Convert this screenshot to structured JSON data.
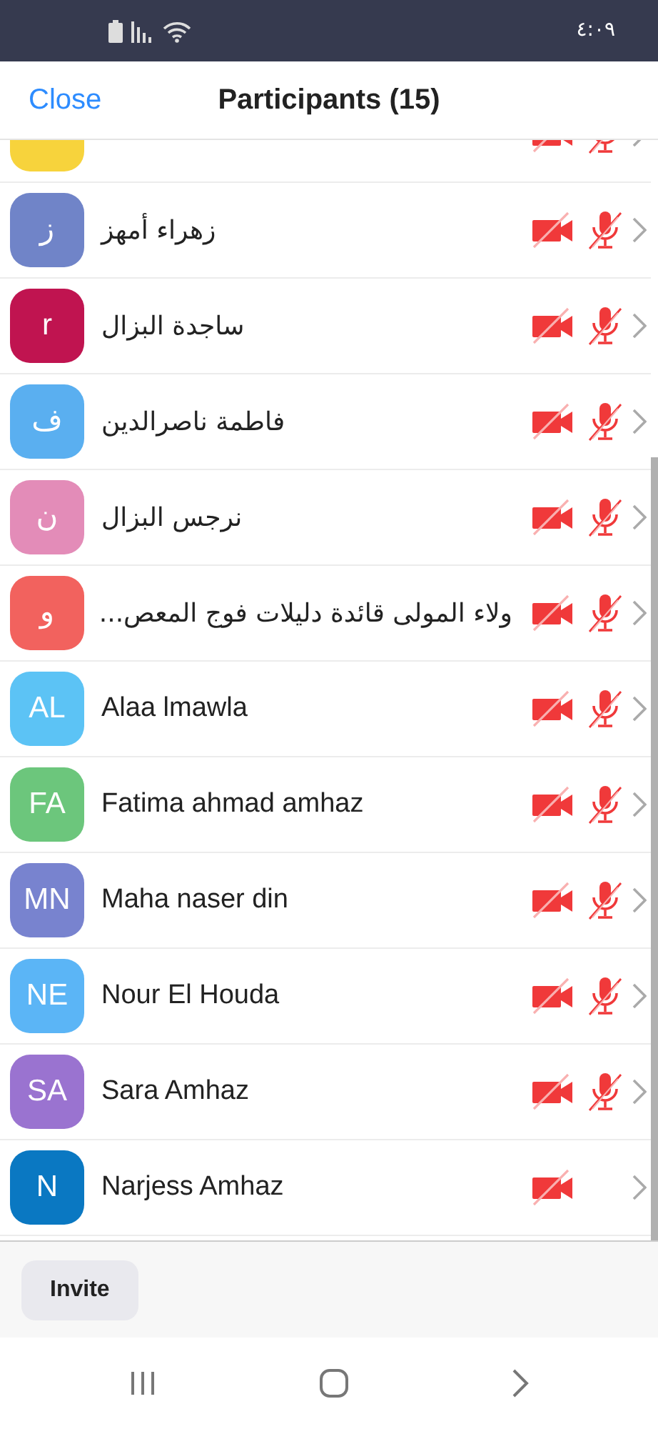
{
  "status_bar": {
    "time": "٤:٠٩"
  },
  "header": {
    "close": "Close",
    "title": "Participants (15)"
  },
  "participants": [
    {
      "kind": "partial",
      "color": "#f7d33c",
      "video_muted": true,
      "mic_muted": true
    },
    {
      "kind": "full",
      "initials": "ز",
      "name": "زهراء أمهز",
      "color": "#7084c8",
      "video_muted": true,
      "mic_muted": true
    },
    {
      "kind": "full",
      "initials": "r",
      "name": "ساجدة البزال",
      "color": "#c01450",
      "video_muted": true,
      "mic_muted": true
    },
    {
      "kind": "full",
      "initials": "ف",
      "name": "فاطمة ناصرالدين",
      "color": "#5aaff0",
      "video_muted": true,
      "mic_muted": true
    },
    {
      "kind": "full",
      "initials": "ن",
      "name": "نرجس البزال",
      "color": "#e38cb8",
      "video_muted": true,
      "mic_muted": true
    },
    {
      "kind": "full",
      "initials": "و",
      "name": "ولاء المولى قائدة دليلات فوج المعص...",
      "color": "#f2625e",
      "video_muted": true,
      "mic_muted": true
    },
    {
      "kind": "full",
      "initials": "AL",
      "name": "Alaa lmawla",
      "color": "#5cc3f5",
      "video_muted": true,
      "mic_muted": true
    },
    {
      "kind": "full",
      "initials": "FA",
      "name": "Fatima ahmad amhaz",
      "color": "#6cc67c",
      "video_muted": true,
      "mic_muted": true
    },
    {
      "kind": "full",
      "initials": "MN",
      "name": "Maha naser din",
      "color": "#7883cf",
      "video_muted": true,
      "mic_muted": true
    },
    {
      "kind": "full",
      "initials": "NE",
      "name": "Nour El Houda",
      "color": "#5bb5f6",
      "video_muted": true,
      "mic_muted": true
    },
    {
      "kind": "full",
      "initials": "SA",
      "name": "Sara Amhaz",
      "color": "#9a73d0",
      "video_muted": true,
      "mic_muted": true
    },
    {
      "kind": "full",
      "initials": "N",
      "name": "Narjess Amhaz",
      "color": "#0a78c2",
      "video_muted": true,
      "mic_muted": false
    }
  ],
  "footer": {
    "invite": "Invite"
  }
}
